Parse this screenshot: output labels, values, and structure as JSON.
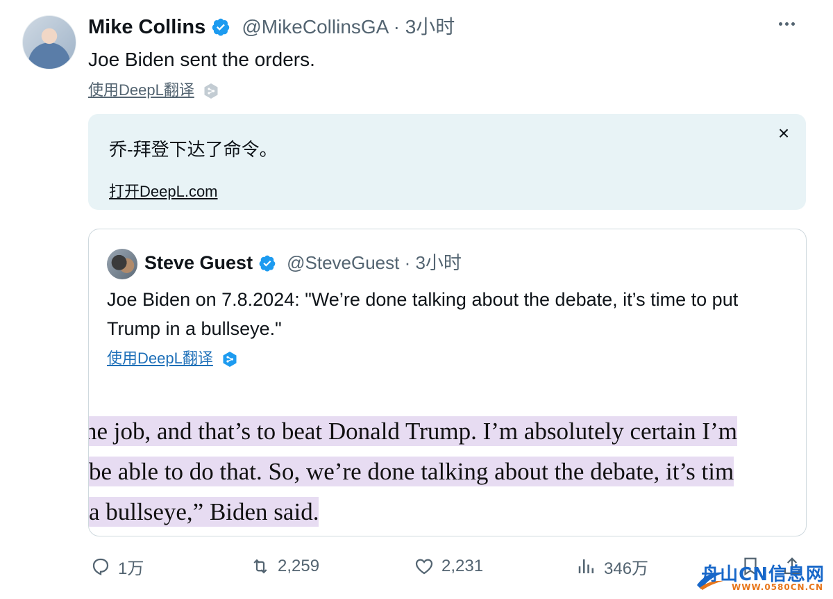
{
  "tweet": {
    "author_name": "Mike Collins",
    "handle_time": "@MikeCollinsGA · 3小时",
    "text": "Joe Biden sent the orders.",
    "translate_label": "使用DeepL翻译"
  },
  "deepl_panel": {
    "translation": "乔-拜登下达了命令。",
    "open_link": "打开DeepL.com",
    "close_symbol": "×"
  },
  "quoted_tweet": {
    "author_name": "Steve Guest",
    "handle_time": "@SteveGuest · 3小时",
    "text": "Joe Biden on 7.8.2024: \"We’re done talking about the debate, it’s time to put Trump in a bullseye.\"",
    "translate_label": "使用DeepL翻译",
    "image_lines": [
      "ne job, and that’s to beat Donald Trump. I’m absolutely certain I’m",
      " be able to do that. So, we’re done talking about the debate, it’s tim",
      " a bullseye,” Biden said."
    ]
  },
  "actions": {
    "replies": "1万",
    "reposts": "2,259",
    "likes": "2,231",
    "views": "346万"
  },
  "watermark": {
    "main": "舟山CN信息网",
    "sub": "WWW.0580CN.CN"
  },
  "colors": {
    "verified": "#1d9bf0",
    "secondary_text": "#536471",
    "deepl_bg": "#e8f3f6",
    "highlight": "#e7dcf2"
  }
}
